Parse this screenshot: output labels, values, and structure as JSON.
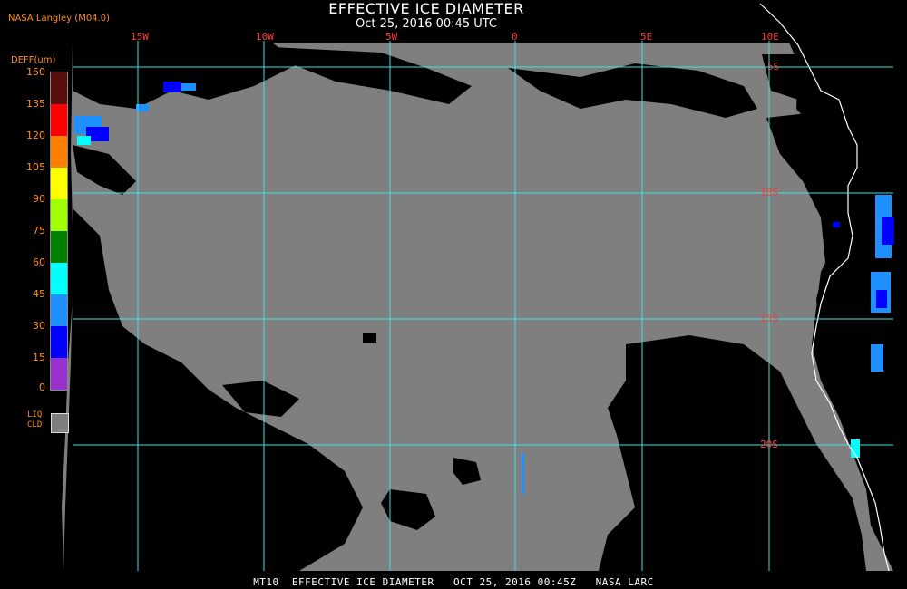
{
  "header": {
    "title": "EFFECTIVE ICE DIAMETER",
    "subtitle": "Oct 25, 2016 00:45 UTC",
    "source": "NASA Langley (M04.0)"
  },
  "legend": {
    "unit_label": "DEFF(um)",
    "ticks": [
      "150",
      "135",
      "120",
      "105",
      "90",
      "75",
      "60",
      "45",
      "30",
      "15",
      "0"
    ],
    "colors": [
      "#5a0f0f",
      "#ff0000",
      "#ff8000",
      "#ffff00",
      "#a0ff00",
      "#008000",
      "#00ffff",
      "#1e90ff",
      "#0000ff",
      "#9932cc"
    ],
    "liq_label_1": "LIQ",
    "liq_label_2": "CLD",
    "liq_color": "#7f7f7f"
  },
  "map": {
    "lon_labels": [
      "15W",
      "10W",
      "5W",
      "0",
      "5E",
      "10E"
    ],
    "lat_labels": [
      "5S",
      "10S",
      "15S",
      "20S"
    ],
    "grid_color": "#40e0e0",
    "liquid_cloud_color": "#7f7f7f"
  },
  "footer": {
    "text": "MT10  EFFECTIVE ICE DIAMETER   OCT 25, 2016 00:45Z   NASA LARC"
  }
}
